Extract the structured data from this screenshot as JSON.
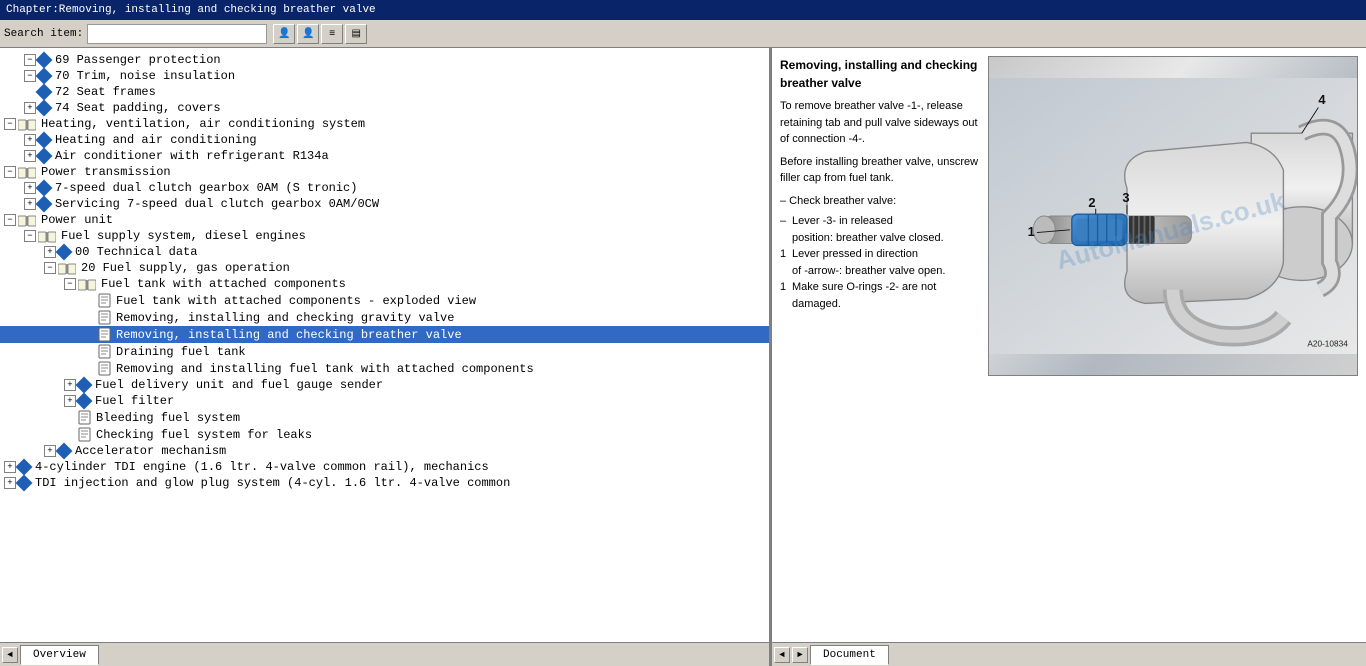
{
  "titlebar": {
    "text": "Chapter:Removing, installing and checking breather valve"
  },
  "toolbar": {
    "search_label": "Search item:",
    "search_placeholder": "",
    "btn_user1": "👤",
    "btn_user2": "👤",
    "btn_menu": "≡",
    "btn_extra": "▤"
  },
  "tree": {
    "items": [
      {
        "id": 1,
        "indent": 1,
        "type": "expandable",
        "expanded": true,
        "icon": "blue-diamond",
        "label": "69 Passenger protection"
      },
      {
        "id": 2,
        "indent": 1,
        "type": "expandable",
        "expanded": true,
        "icon": "blue-diamond",
        "label": "70 Trim, noise insulation"
      },
      {
        "id": 3,
        "indent": 1,
        "type": "item",
        "icon": "blue-diamond",
        "label": "72 Seat frames"
      },
      {
        "id": 4,
        "indent": 1,
        "type": "expandable",
        "icon": "blue-diamond",
        "label": "74 Seat padding, covers"
      },
      {
        "id": 5,
        "indent": 0,
        "type": "expandable",
        "expanded": true,
        "icon": "open-book",
        "label": "Heating, ventilation, air conditioning system"
      },
      {
        "id": 6,
        "indent": 1,
        "type": "expandable",
        "icon": "blue-diamond",
        "label": "Heating and air conditioning"
      },
      {
        "id": 7,
        "indent": 1,
        "type": "expandable",
        "icon": "blue-diamond",
        "label": "Air conditioner with refrigerant R134a"
      },
      {
        "id": 8,
        "indent": 0,
        "type": "expandable",
        "expanded": true,
        "icon": "open-book",
        "label": "Power transmission"
      },
      {
        "id": 9,
        "indent": 1,
        "type": "expandable",
        "icon": "blue-diamond",
        "label": "7-speed dual clutch gearbox 0AM (S tronic)"
      },
      {
        "id": 10,
        "indent": 1,
        "type": "expandable",
        "icon": "blue-diamond",
        "label": "Servicing 7-speed dual clutch gearbox 0AM/0CW"
      },
      {
        "id": 11,
        "indent": 0,
        "type": "expandable",
        "expanded": true,
        "icon": "open-book",
        "label": "Power unit"
      },
      {
        "id": 12,
        "indent": 1,
        "type": "expandable",
        "expanded": true,
        "icon": "open-book",
        "label": "Fuel supply system, diesel engines"
      },
      {
        "id": 13,
        "indent": 2,
        "type": "expandable",
        "icon": "blue-diamond",
        "label": "00 Technical data"
      },
      {
        "id": 14,
        "indent": 2,
        "type": "expandable",
        "expanded": true,
        "icon": "open-book",
        "label": "20 Fuel supply, gas operation"
      },
      {
        "id": 15,
        "indent": 3,
        "type": "expandable",
        "expanded": true,
        "icon": "open-book",
        "label": "Fuel tank with attached components"
      },
      {
        "id": 16,
        "indent": 4,
        "type": "doc",
        "label": "Fuel tank with attached components - exploded view"
      },
      {
        "id": 17,
        "indent": 4,
        "type": "doc",
        "label": "Removing, installing and checking gravity valve"
      },
      {
        "id": 18,
        "indent": 4,
        "type": "doc",
        "label": "Removing, installing and checking breather valve",
        "selected": true
      },
      {
        "id": 19,
        "indent": 4,
        "type": "doc",
        "label": "Draining fuel tank"
      },
      {
        "id": 20,
        "indent": 4,
        "type": "doc",
        "label": "Removing and installing fuel tank with attached components"
      },
      {
        "id": 21,
        "indent": 3,
        "type": "expandable",
        "icon": "blue-diamond",
        "label": "Fuel delivery unit and fuel gauge sender"
      },
      {
        "id": 22,
        "indent": 3,
        "type": "expandable",
        "icon": "blue-diamond",
        "label": "Fuel filter"
      },
      {
        "id": 23,
        "indent": 3,
        "type": "doc",
        "label": "Bleeding fuel system"
      },
      {
        "id": 24,
        "indent": 3,
        "type": "doc",
        "label": "Checking fuel system for leaks"
      },
      {
        "id": 25,
        "indent": 2,
        "type": "expandable",
        "icon": "blue-diamond",
        "label": "Accelerator mechanism"
      },
      {
        "id": 26,
        "indent": 0,
        "type": "expandable",
        "icon": "blue-diamond",
        "label": "4-cylinder TDI engine (1.6 ltr. 4-valve common rail), mechanics"
      },
      {
        "id": 27,
        "indent": 0,
        "type": "expandable",
        "icon": "blue-diamond",
        "label": "TDI injection and glow plug system (4-cyl. 1.6 ltr. 4-valve common"
      }
    ]
  },
  "document": {
    "title": "Removing, installing and checking breather valve",
    "para1": "To remove breather valve -1-, release retaining tab and pull valve sideways out of connection -4-.",
    "para2": "Before installing breather valve, unscrew filler cap from fuel tank.",
    "para3": "– Check breather valve:",
    "step1_label": "Lever -3- in released",
    "step1_text": "position: breather valve closed.",
    "step2_label": "Lever pressed in direction",
    "step2_text": "of -arrow-: breather valve open.",
    "step3_text": "Make sure O-rings -2- are not damaged.",
    "image_ref": "A20-10834",
    "watermark": "AutoManuals.co.uk",
    "part_labels": [
      "1",
      "2",
      "3",
      "4"
    ]
  },
  "tabs": {
    "left_tabs": [
      {
        "label": "Overview",
        "active": true
      }
    ],
    "right_tabs": [
      {
        "label": "Document",
        "active": true
      }
    ]
  },
  "scrollbar": {
    "left_arrow": "◄",
    "right_arrow": "►",
    "up_arrow": "▲",
    "down_arrow": "▼"
  }
}
